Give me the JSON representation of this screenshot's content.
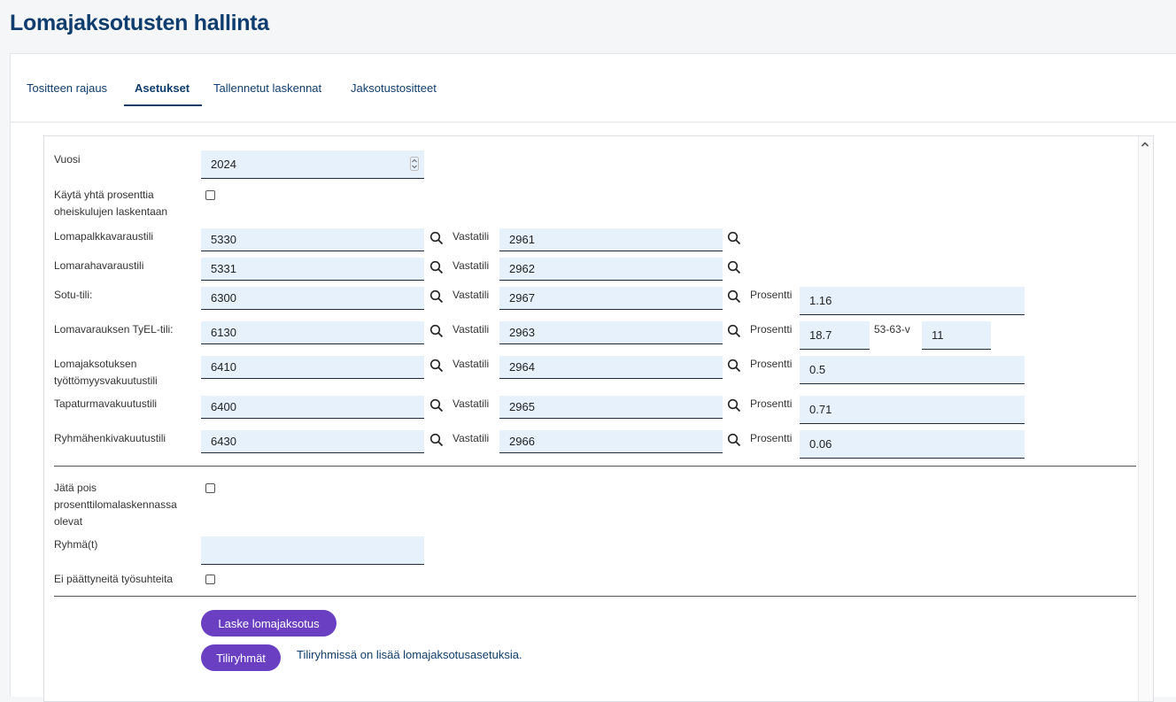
{
  "page": {
    "title": "Lomajaksotusten hallinta"
  },
  "tabs": [
    {
      "label": "Tositteen rajaus"
    },
    {
      "label": "Asetukset"
    },
    {
      "label": "Tallennetut laskennat"
    },
    {
      "label": "Jaksotustositteet"
    }
  ],
  "settings": {
    "year_label": "Vuosi",
    "year_value": "2024",
    "same_pct_label_1": "Käytä yhtä prosenttia",
    "same_pct_label_2": "oheiskulujen laskentaan",
    "vastatili_label": "Vastatili",
    "prosentti_label": "Prosentti",
    "age_label": "53-63-v",
    "rows": [
      {
        "label": "Lomapalkkavaraustili",
        "account": "5330",
        "counter": "2961"
      },
      {
        "label": "Lomarahavaraustili",
        "account": "5331",
        "counter": "2962"
      },
      {
        "label": "Sotu-tili:",
        "account": "6300",
        "counter": "2967",
        "percent": "1.16"
      },
      {
        "label": "Lomavarauksen TyEL-tili:",
        "account": "6130",
        "counter": "2963",
        "percent": "18.7",
        "percent2": "11"
      },
      {
        "label": "Lomajaksotuksen",
        "label2": "työttömyysvakuutustili",
        "account": "6410",
        "counter": "2964",
        "percent": "0.5"
      },
      {
        "label": "Tapaturmavakuutustili",
        "account": "6400",
        "counter": "2965",
        "percent": "0.71"
      },
      {
        "label": "Ryhmähenkivakuutustili",
        "account": "6430",
        "counter": "2966",
        "percent": "0.06"
      }
    ],
    "exclude_label_1": "Jätä pois",
    "exclude_label_2": "prosenttilomalaskennassa",
    "exclude_label_3": "olevat",
    "groups_label": "Ryhmä(t)",
    "groups_value": "",
    "no_ended_label": "Ei päättyneitä työsuhteita"
  },
  "actions": {
    "calculate": "Laske lomajaksotus",
    "account_groups": "Tiliryhmät",
    "note": "Tiliryhmissä on lisää lomajaksotusasetuksia."
  }
}
